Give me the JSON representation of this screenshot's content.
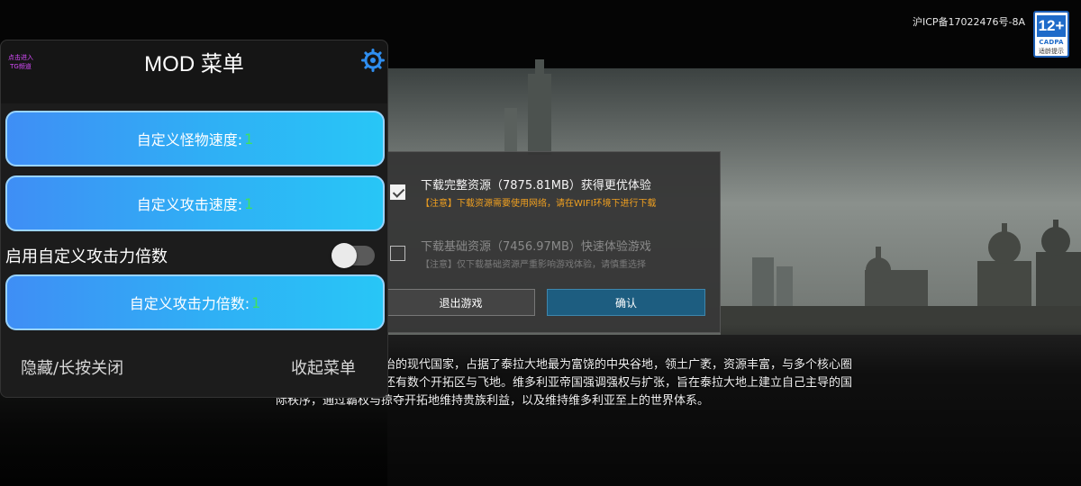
{
  "top_right": {
    "icp": "沪ICP备17022476号-8A",
    "age_rating": "12+",
    "age_org": "CADPA",
    "age_tip": "适龄提示"
  },
  "description": {
    "line1": "治的现代国家，占据了泰拉大地最为富饶的中央谷地，领土广袤，资源丰富，与多个核心圈",
    "line2": "还有数个开拓区与飞地。维多利亚帝国强调强权与扩张，旨在泰拉大地上建立自己主导的国",
    "line3": "际秩序，通过霸权与掠夺开拓地维持贵族利益，以及维持维多利亚至上的世界体系。"
  },
  "dialog": {
    "option_full": {
      "checked": true,
      "title": "下载完整资源（7875.81MB）获得更优体验",
      "note": "【注意】下载资源需要使用网络，请在WIFI环境下进行下载"
    },
    "option_basic": {
      "checked": false,
      "title": "下载基础资源（7456.97MB）快速体验游戏",
      "note": "【注意】仅下载基础资源严重影响游戏体验，请慎重选择"
    },
    "exit_label": "退出游戏",
    "confirm_label": "确认"
  },
  "mod_menu": {
    "hint_line1": "点击进入",
    "hint_line2": "TG频道",
    "title": "MOD 菜单",
    "monster_speed": {
      "label": "自定义怪物速度:",
      "value": "1"
    },
    "attack_speed": {
      "label": "自定义攻击速度:",
      "value": "1"
    },
    "toggle_label": "启用自定义攻击力倍数",
    "toggle_on": false,
    "attack_multiplier": {
      "label": "自定义攻击力倍数:",
      "value": "1"
    },
    "hide_label": "隐藏/长按关闭",
    "collapse_label": "收起菜单"
  }
}
